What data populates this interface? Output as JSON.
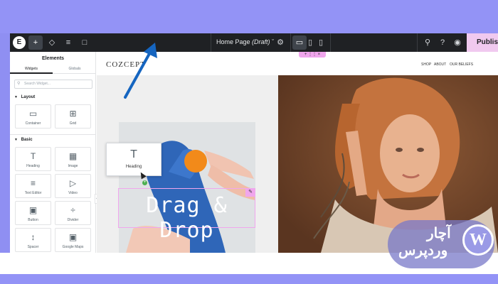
{
  "topbar": {
    "page_title": "Home Page",
    "page_status": "(Draft)",
    "publish_label": "Publish"
  },
  "panel": {
    "title": "Elements",
    "tabs": [
      {
        "label": "Widgets"
      },
      {
        "label": "Globals"
      }
    ],
    "search_placeholder": "Search Widget...",
    "categories": [
      {
        "label": "Layout",
        "widgets": [
          {
            "label": "Container",
            "icon": "container-icon"
          },
          {
            "label": "Grid",
            "icon": "grid-icon"
          }
        ]
      },
      {
        "label": "Basic",
        "widgets": [
          {
            "label": "Heading",
            "icon": "heading-icon"
          },
          {
            "label": "Image",
            "icon": "image-icon"
          },
          {
            "label": "Text Editor",
            "icon": "text-editor-icon"
          },
          {
            "label": "Video",
            "icon": "video-icon"
          },
          {
            "label": "Button",
            "icon": "button-icon"
          },
          {
            "label": "Divider",
            "icon": "divider-icon"
          },
          {
            "label": "Spacer",
            "icon": "spacer-icon"
          },
          {
            "label": "Google Maps",
            "icon": "map-icon"
          }
        ]
      }
    ]
  },
  "canvas": {
    "site_logo": "COZCEPT",
    "nav": [
      {
        "label": "SHOP"
      },
      {
        "label": "ABOUT"
      },
      {
        "label": "OUR BELIEFS"
      }
    ],
    "headline": "Drag & Drop",
    "dragged_widget": {
      "label": "Heading",
      "icon": "heading-icon"
    }
  },
  "watermark": {
    "line1": "آچار",
    "line2": "وردپرس",
    "logo": "W"
  },
  "colors": {
    "accent_pink": "#f0a6ed",
    "topbar": "#1f2124",
    "frame": "#9393f6",
    "arrow": "#1565c0"
  }
}
